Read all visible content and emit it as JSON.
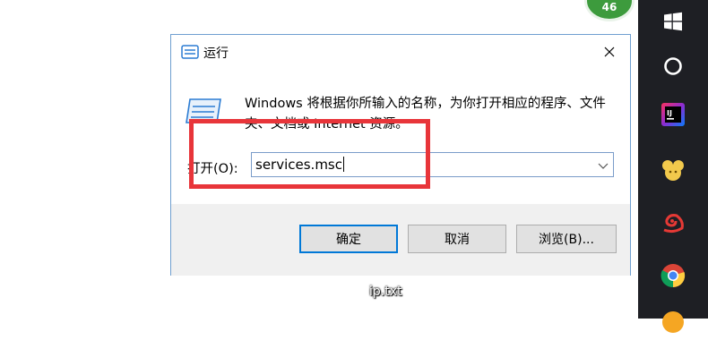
{
  "notification": {
    "count": "46"
  },
  "dialog": {
    "title": "运行",
    "description": "Windows 将根据你所输入的名称，为你打开相应的程序、文件夹、文档或 Internet 资源。",
    "open_label": "打开(O):",
    "input_value": "services.msc",
    "ok_label": "确定",
    "cancel_label": "取消",
    "browse_label": "浏览(B)..."
  },
  "desktop": {
    "file_label": "ip.txt"
  },
  "taskbar": {
    "items": [
      "windows-icon",
      "cortana-icon",
      "intellij-idea-icon",
      "yellow-app-icon",
      "snail-app-icon",
      "chrome-icon",
      "partial-app-icon"
    ]
  },
  "colors": {
    "accent": "#0078d7",
    "highlight": "#e8353a",
    "taskbar": "#1e1f24"
  }
}
